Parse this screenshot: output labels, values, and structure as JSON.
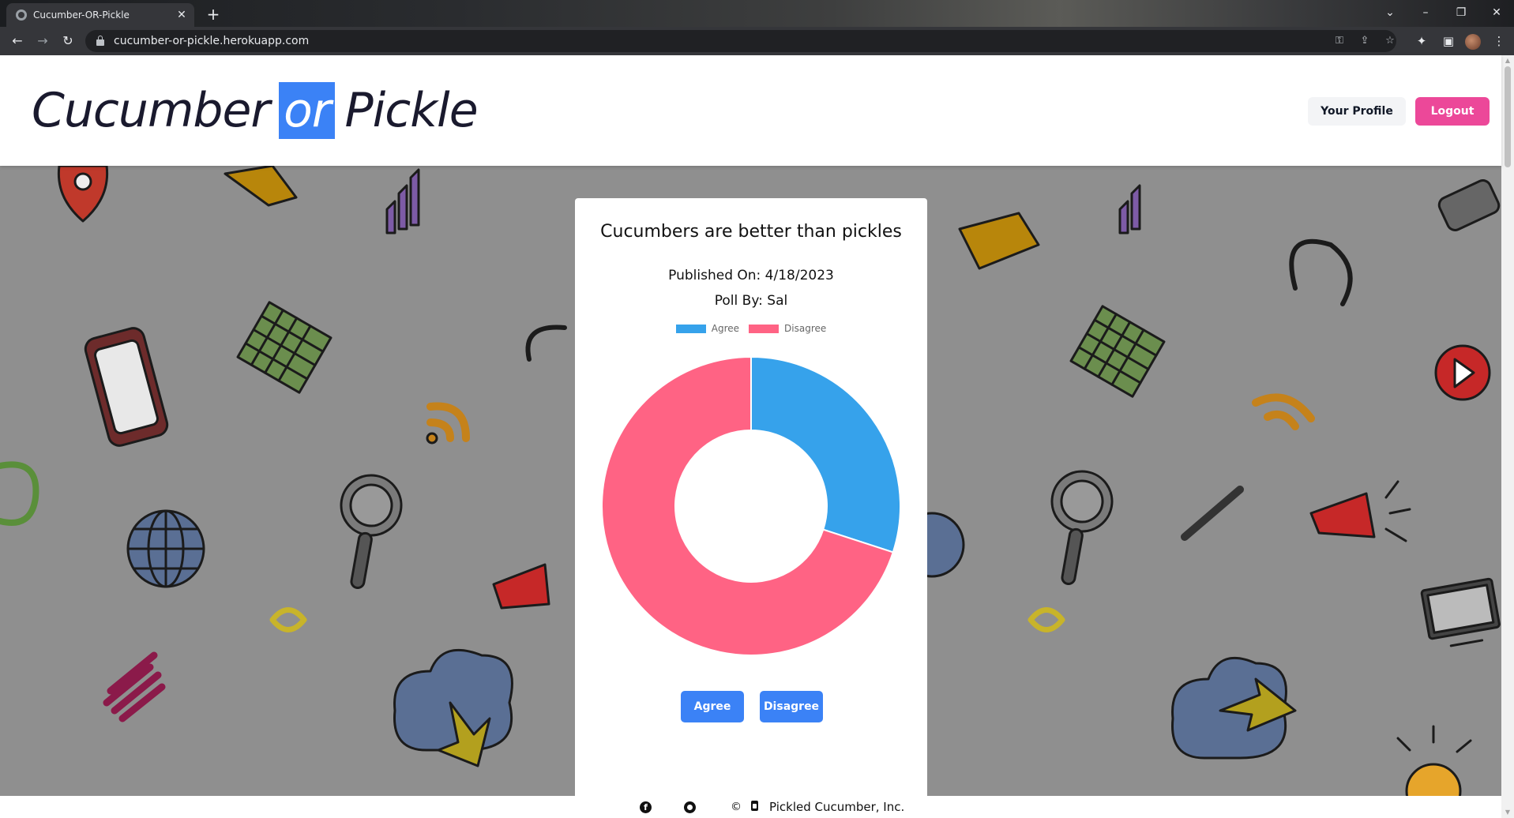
{
  "browser": {
    "tab_title": "Cucumber-OR-Pickle",
    "url": "cucumber-or-pickle.herokuapp.com",
    "icons": [
      "back-icon",
      "forward-icon",
      "reload-icon",
      "lock-icon",
      "key-icon",
      "share-icon",
      "star-icon",
      "extensions-icon",
      "sidepanel-icon",
      "profile-avatar",
      "menu-icon"
    ]
  },
  "header": {
    "logo_left": "Cucumber",
    "logo_mid": "or",
    "logo_right": "Pickle",
    "profile_label": "Your Profile",
    "logout_label": "Logout"
  },
  "poll": {
    "title": "Cucumbers are better than pickles",
    "published": "Published On: 4/18/2023",
    "author": "Poll By: Sal",
    "agree_label": "Agree",
    "disagree_label": "Disagree"
  },
  "chart_data": {
    "type": "pie",
    "donut": true,
    "categories": [
      "Agree",
      "Disagree"
    ],
    "values": [
      30,
      70
    ],
    "colors": [
      "#36a2eb",
      "#ff6384"
    ],
    "legend": "top"
  },
  "footer": {
    "copyright_symbol": "©",
    "company": "Pickled Cucumber, Inc."
  },
  "colors": {
    "accent_blue": "#3b82f6",
    "logout_pink": "#ec4899",
    "background_gray": "#8f8f8f"
  }
}
